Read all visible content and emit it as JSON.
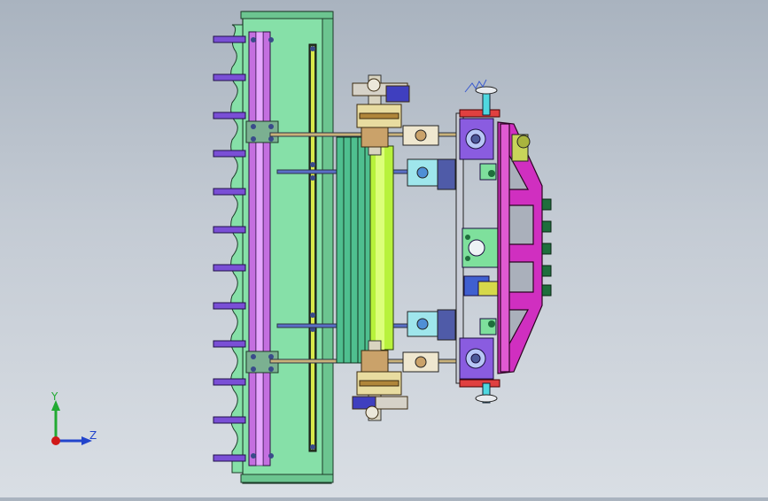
{
  "triad": {
    "y_label": "Y",
    "z_label": "Z"
  },
  "colors": {
    "background_top": "#a9b3bf",
    "background_bottom": "#d9dee4",
    "frame_green": "#86e0a8",
    "frame_dark_green": "#5fae7e",
    "purple": "#7a4fd6",
    "magenta": "#d02fc0",
    "shaft_yellow_green": "#b8f23c",
    "cyan": "#4fd8e0",
    "axis_y": "#22aa33",
    "axis_z": "#2244cc",
    "axis_x": "#d01818"
  },
  "model": {
    "view_name": "",
    "icons": [
      "coordinate-triad-icon"
    ]
  }
}
